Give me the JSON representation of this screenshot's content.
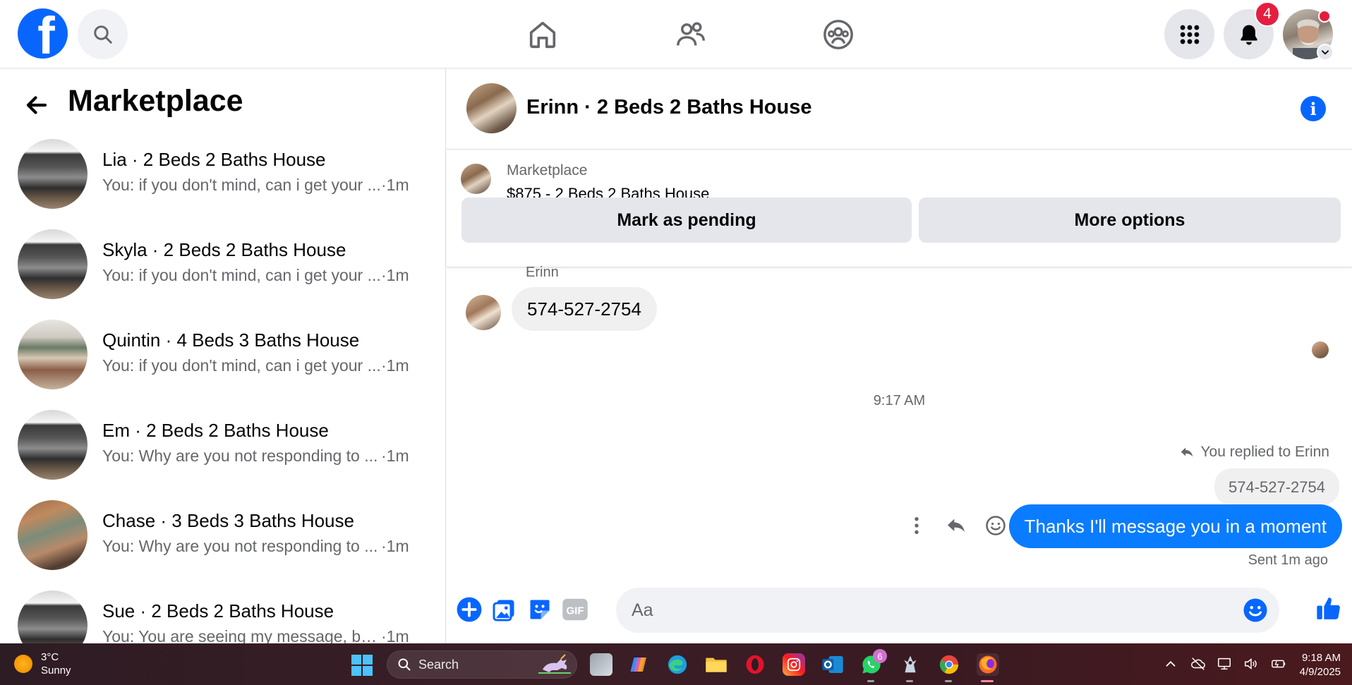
{
  "topnav": {
    "logo_letter": "f",
    "notifications_count": "4"
  },
  "left": {
    "title": "Marketplace",
    "conversations": [
      {
        "title": "Lia · 2 Beds 2 Baths House",
        "preview": "You: if you don't mind, can i get your ...",
        "time": "·1m",
        "thumb": "kitchen"
      },
      {
        "title": "Skyla · 2 Beds 2 Baths House",
        "preview": "You: if you don't mind, can i get your ...",
        "time": "·1m",
        "thumb": "kitchen"
      },
      {
        "title": "Quintin · 4 Beds 3 Baths House",
        "preview": "You: if you don't mind, can i get your ...",
        "time": "·1m",
        "thumb": "bedroom"
      },
      {
        "title": "Em · 2 Beds 2 Baths House",
        "preview": "You: Why are you not responding to ...",
        "time": "·1m",
        "thumb": "kitchen"
      },
      {
        "title": "Chase · 3 Beds 3 Baths House",
        "preview": "You: Why are you not responding to ...",
        "time": "·1m",
        "thumb": "living"
      },
      {
        "title": "Sue · 2 Beds 2 Baths House",
        "preview": "You: You are seeing my message, but ...",
        "time": "·1m",
        "thumb": "kitchen"
      }
    ]
  },
  "chat": {
    "title": "Erinn · 2 Beds 2 Baths House",
    "listing": {
      "label": "Marketplace",
      "price_title": "$875 - 2 Beds 2 Baths House",
      "mark_pending": "Mark as pending",
      "more_options": "More options"
    },
    "incoming": {
      "sender": "Erinn",
      "text": "574-527-2754"
    },
    "timestamp": "9:17 AM",
    "replied_label": "You replied to Erinn",
    "quoted_text": "574-527-2754",
    "outgoing_text": "Thanks I'll message you in a moment",
    "sent_status": "Sent 1m ago",
    "composer_placeholder": "Aa"
  },
  "taskbar": {
    "weather_temp": "3°C",
    "weather_desc": "Sunny",
    "search_label": "Search",
    "whatsapp_badge": "6",
    "clock_time": "9:18 AM",
    "clock_date": "4/9/2025"
  },
  "colors": {
    "brand_blue": "#0866ff",
    "outgoing_bubble": "#0a7cff",
    "badge_red": "#e41e3f"
  }
}
